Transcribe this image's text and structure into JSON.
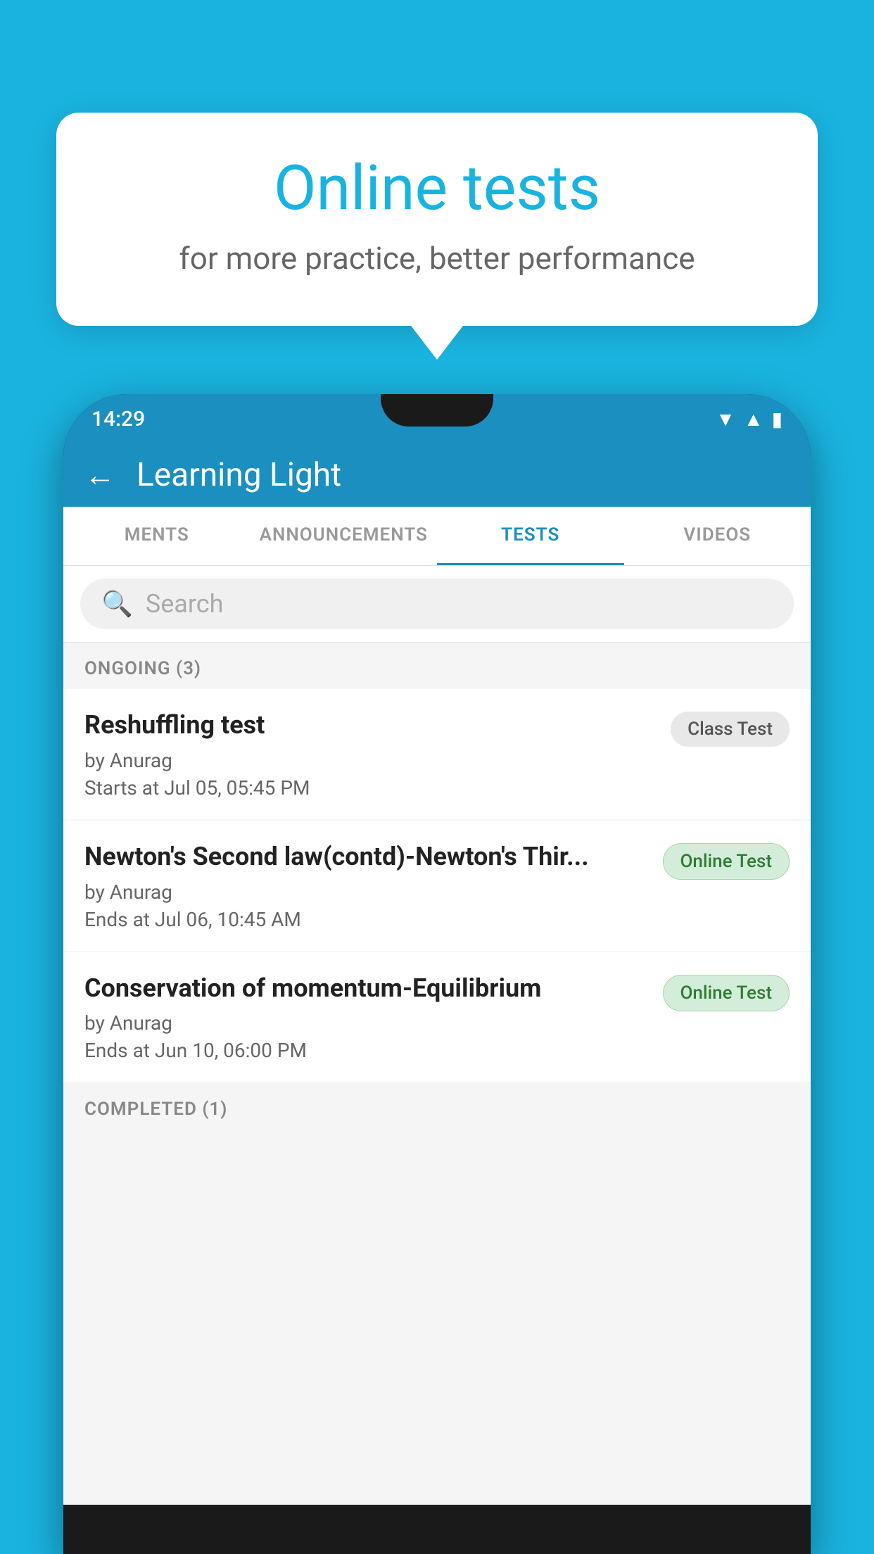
{
  "background": {
    "color": "#1ab3e0"
  },
  "promo": {
    "title": "Online tests",
    "subtitle": "for more practice, better performance"
  },
  "phone": {
    "status_bar": {
      "time": "14:29",
      "icons": [
        "wifi",
        "signal",
        "battery"
      ]
    },
    "app_header": {
      "back_label": "←",
      "title": "Learning Light"
    },
    "tabs": [
      {
        "label": "MENTS",
        "active": false
      },
      {
        "label": "ANNOUNCEMENTS",
        "active": false
      },
      {
        "label": "TESTS",
        "active": true
      },
      {
        "label": "VIDEOS",
        "active": false
      }
    ],
    "search": {
      "placeholder": "Search"
    },
    "sections": [
      {
        "label": "ONGOING (3)",
        "items": [
          {
            "name": "Reshuffling test",
            "author": "by Anurag",
            "time_label": "Starts at",
            "time": "Jul 05, 05:45 PM",
            "badge": "Class Test",
            "badge_type": "class"
          },
          {
            "name": "Newton's Second law(contd)-Newton's Thir...",
            "author": "by Anurag",
            "time_label": "Ends at",
            "time": "Jul 06, 10:45 AM",
            "badge": "Online Test",
            "badge_type": "online"
          },
          {
            "name": "Conservation of momentum-Equilibrium",
            "author": "by Anurag",
            "time_label": "Ends at",
            "time": "Jun 10, 06:00 PM",
            "badge": "Online Test",
            "badge_type": "online"
          }
        ]
      }
    ],
    "bottom_section_label": "COMPLETED (1)"
  }
}
